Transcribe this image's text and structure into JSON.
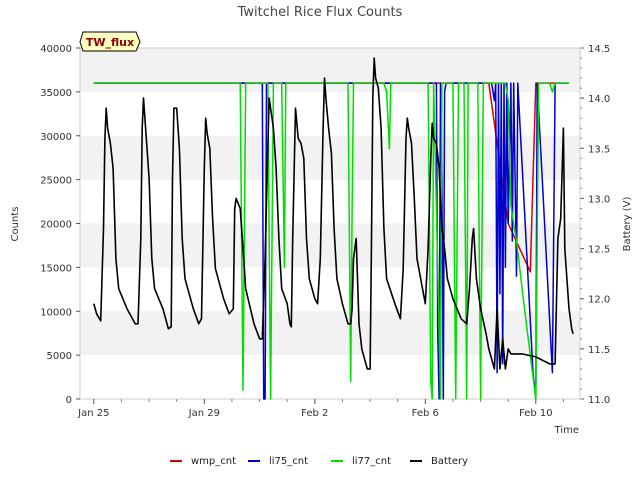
{
  "chart_data": {
    "type": "line",
    "title": "Twitchel Rice Flux Counts",
    "tag_label": "TW_flux",
    "xlabel": "Time",
    "ylabel": "Counts",
    "y2label": "Battery (V)",
    "xlim": [
      -0.5,
      11.6
    ],
    "ylim": [
      0,
      40000
    ],
    "y2lim": [
      11.0,
      14.5
    ],
    "x_ticks": [
      {
        "v": 0,
        "label": "Jan 25"
      },
      {
        "v": 4,
        "label": "Jan 29"
      },
      {
        "v": 8,
        "label": "Feb 2"
      },
      {
        "v": 12,
        "label": "Feb 6"
      },
      {
        "v": 16,
        "label": "Feb 10"
      }
    ],
    "x_tick_day_offset": 0,
    "y_ticks": [
      0,
      5000,
      10000,
      15000,
      20000,
      25000,
      30000,
      35000,
      40000
    ],
    "y2_ticks": [
      "11.0",
      "11.5",
      "12.0",
      "12.5",
      "13.0",
      "13.5",
      "14.0",
      "14.5"
    ],
    "grid": "horizontal bands",
    "legend_position": "bottom",
    "series": [
      {
        "name": "wmp_cnt",
        "color": "#dd0000",
        "axis": "left",
        "points": [
          [
            0,
            36000
          ],
          [
            11.9,
            36000
          ],
          [
            12.1,
            36000
          ],
          [
            13.6,
            36000
          ],
          [
            14.3,
            36000
          ],
          [
            15.0,
            20000
          ],
          [
            15.8,
            14500
          ],
          [
            16.0,
            36000
          ],
          [
            16.7,
            36000
          ]
        ]
      },
      {
        "name": "li75_cnt",
        "color": "#0000cc",
        "axis": "left",
        "points": [
          [
            0,
            36000
          ],
          [
            5.5,
            36000
          ],
          [
            5.9,
            36000
          ],
          [
            6.1,
            36000
          ],
          [
            6.15,
            0
          ],
          [
            6.2,
            0
          ],
          [
            6.25,
            36000
          ],
          [
            8.9,
            36000
          ],
          [
            9.0,
            36000
          ],
          [
            12.4,
            36000
          ],
          [
            12.45,
            8000
          ],
          [
            12.5,
            0
          ],
          [
            12.55,
            36000
          ],
          [
            12.6,
            25000
          ],
          [
            12.65,
            0
          ],
          [
            12.7,
            35000
          ],
          [
            12.75,
            36000
          ],
          [
            14.4,
            36000
          ],
          [
            14.5,
            34000
          ],
          [
            14.55,
            36000
          ],
          [
            14.6,
            3000
          ],
          [
            14.65,
            36000
          ],
          [
            14.7,
            12000
          ],
          [
            14.75,
            36000
          ],
          [
            14.8,
            4000
          ],
          [
            14.85,
            36000
          ],
          [
            14.9,
            15000
          ],
          [
            14.95,
            36000
          ],
          [
            15.0,
            20000
          ],
          [
            15.1,
            36000
          ],
          [
            15.15,
            18000
          ],
          [
            15.2,
            36000
          ],
          [
            15.3,
            14000
          ],
          [
            15.35,
            36000
          ],
          [
            15.9,
            3000
          ],
          [
            16.0,
            0
          ],
          [
            16.05,
            36000
          ],
          [
            16.6,
            3000
          ],
          [
            16.7,
            36000
          ],
          [
            17.2,
            36000
          ]
        ]
      },
      {
        "name": "li77_cnt",
        "color": "#00dd00",
        "axis": "left",
        "points": [
          [
            0,
            36000
          ],
          [
            5.3,
            36000
          ],
          [
            5.4,
            1000
          ],
          [
            5.5,
            36000
          ],
          [
            6.3,
            36000
          ],
          [
            6.4,
            0
          ],
          [
            6.5,
            36000
          ],
          [
            6.8,
            36000
          ],
          [
            6.9,
            15000
          ],
          [
            6.95,
            36000
          ],
          [
            9.2,
            36000
          ],
          [
            9.3,
            2000
          ],
          [
            9.35,
            21500
          ],
          [
            9.4,
            36000
          ],
          [
            10.5,
            36000
          ],
          [
            10.6,
            35000
          ],
          [
            10.7,
            28500
          ],
          [
            10.75,
            36000
          ],
          [
            12.1,
            36000
          ],
          [
            12.2,
            2000
          ],
          [
            12.25,
            0
          ],
          [
            12.3,
            36000
          ],
          [
            12.5,
            8000
          ],
          [
            12.55,
            0
          ],
          [
            12.6,
            36000
          ],
          [
            13.0,
            36000
          ],
          [
            13.1,
            0
          ],
          [
            13.2,
            36000
          ],
          [
            13.4,
            36000
          ],
          [
            13.5,
            0
          ],
          [
            13.55,
            36000
          ],
          [
            13.9,
            36000
          ],
          [
            14.0,
            0
          ],
          [
            14.1,
            36000
          ],
          [
            14.9,
            36000
          ],
          [
            15.0,
            34000
          ],
          [
            15.1,
            22000
          ],
          [
            15.3,
            18000
          ],
          [
            15.6,
            10000
          ],
          [
            15.8,
            5000
          ],
          [
            15.9,
            2500
          ],
          [
            16.0,
            0
          ],
          [
            16.1,
            36000
          ],
          [
            16.5,
            36000
          ],
          [
            16.6,
            35000
          ],
          [
            16.7,
            36000
          ],
          [
            17.2,
            36000
          ]
        ]
      },
      {
        "name": "Battery",
        "color": "#000000",
        "axis": "right",
        "points": [
          [
            0,
            11.95
          ],
          [
            0.1,
            11.85
          ],
          [
            0.25,
            11.78
          ],
          [
            0.35,
            12.7
          ],
          [
            0.4,
            13.6
          ],
          [
            0.45,
            13.9
          ],
          [
            0.5,
            13.7
          ],
          [
            0.6,
            13.55
          ],
          [
            0.7,
            13.3
          ],
          [
            0.8,
            12.4
          ],
          [
            0.9,
            12.1
          ],
          [
            1.2,
            11.9
          ],
          [
            1.5,
            11.75
          ],
          [
            1.6,
            11.75
          ],
          [
            1.7,
            12.6
          ],
          [
            1.75,
            13.7
          ],
          [
            1.8,
            14.0
          ],
          [
            1.9,
            13.6
          ],
          [
            2.0,
            13.2
          ],
          [
            2.1,
            12.4
          ],
          [
            2.2,
            12.1
          ],
          [
            2.5,
            11.9
          ],
          [
            2.7,
            11.7
          ],
          [
            2.8,
            11.72
          ],
          [
            2.85,
            13.2
          ],
          [
            2.9,
            13.9
          ],
          [
            3.0,
            13.9
          ],
          [
            3.1,
            13.5
          ],
          [
            3.2,
            12.6
          ],
          [
            3.3,
            12.2
          ],
          [
            3.6,
            11.9
          ],
          [
            3.8,
            11.75
          ],
          [
            3.9,
            11.8
          ],
          [
            4.0,
            13.3
          ],
          [
            4.05,
            13.8
          ],
          [
            4.1,
            13.65
          ],
          [
            4.2,
            13.5
          ],
          [
            4.3,
            12.8
          ],
          [
            4.4,
            12.3
          ],
          [
            4.7,
            12.0
          ],
          [
            4.9,
            11.85
          ],
          [
            5.05,
            11.9
          ],
          [
            5.1,
            12.9
          ],
          [
            5.15,
            13.0
          ],
          [
            5.3,
            12.9
          ],
          [
            5.4,
            12.5
          ],
          [
            5.5,
            12.1
          ],
          [
            5.8,
            11.75
          ],
          [
            6.0,
            11.6
          ],
          [
            6.1,
            11.6
          ],
          [
            6.2,
            12.4
          ],
          [
            6.3,
            13.5
          ],
          [
            6.35,
            14.0
          ],
          [
            6.4,
            13.9
          ],
          [
            6.5,
            13.7
          ],
          [
            6.6,
            13.3
          ],
          [
            6.7,
            12.6
          ],
          [
            6.8,
            12.1
          ],
          [
            7.0,
            11.95
          ],
          [
            7.1,
            11.75
          ],
          [
            7.15,
            11.72
          ],
          [
            7.2,
            12.6
          ],
          [
            7.3,
            13.9
          ],
          [
            7.4,
            13.6
          ],
          [
            7.5,
            13.55
          ],
          [
            7.6,
            13.4
          ],
          [
            7.7,
            12.6
          ],
          [
            7.8,
            12.2
          ],
          [
            8.0,
            12.0
          ],
          [
            8.1,
            11.95
          ],
          [
            8.2,
            12.4
          ],
          [
            8.3,
            13.7
          ],
          [
            8.35,
            14.2
          ],
          [
            8.4,
            14.0
          ],
          [
            8.5,
            13.7
          ],
          [
            8.6,
            13.45
          ],
          [
            8.7,
            12.7
          ],
          [
            8.8,
            12.2
          ],
          [
            9.0,
            11.95
          ],
          [
            9.2,
            11.75
          ],
          [
            9.3,
            11.75
          ],
          [
            9.35,
            11.9
          ],
          [
            9.4,
            12.4
          ],
          [
            9.5,
            12.6
          ],
          [
            9.6,
            11.75
          ],
          [
            9.7,
            11.5
          ],
          [
            9.8,
            11.4
          ],
          [
            9.9,
            11.3
          ],
          [
            10.0,
            11.3
          ],
          [
            10.05,
            12.5
          ],
          [
            10.1,
            14.0
          ],
          [
            10.15,
            14.4
          ],
          [
            10.2,
            14.2
          ],
          [
            10.3,
            14.1
          ],
          [
            10.4,
            13.7
          ],
          [
            10.5,
            12.7
          ],
          [
            10.6,
            12.2
          ],
          [
            10.9,
            11.95
          ],
          [
            11.1,
            11.8
          ],
          [
            11.2,
            12.3
          ],
          [
            11.3,
            13.6
          ],
          [
            11.35,
            13.8
          ],
          [
            11.4,
            13.7
          ],
          [
            11.5,
            13.55
          ],
          [
            11.6,
            13.0
          ],
          [
            11.7,
            12.4
          ],
          [
            11.9,
            12.1
          ],
          [
            12.0,
            11.95
          ],
          [
            12.1,
            12.5
          ],
          [
            12.2,
            13.4
          ],
          [
            12.25,
            13.75
          ],
          [
            12.3,
            13.6
          ],
          [
            12.4,
            13.55
          ],
          [
            12.5,
            13.3
          ],
          [
            12.6,
            12.7
          ],
          [
            12.7,
            12.5
          ],
          [
            12.8,
            12.2
          ],
          [
            13.0,
            12.0
          ],
          [
            13.3,
            11.8
          ],
          [
            13.5,
            11.75
          ],
          [
            13.6,
            12.1
          ],
          [
            13.7,
            12.6
          ],
          [
            13.75,
            12.7
          ],
          [
            13.85,
            12.2
          ],
          [
            14.0,
            11.9
          ],
          [
            14.2,
            11.65
          ],
          [
            14.3,
            11.5
          ],
          [
            14.4,
            11.4
          ],
          [
            14.5,
            11.3
          ],
          [
            14.6,
            11.9
          ],
          [
            14.7,
            11.3
          ],
          [
            14.8,
            11.6
          ],
          [
            14.9,
            11.3
          ],
          [
            15.0,
            11.5
          ],
          [
            15.1,
            11.45
          ],
          [
            15.5,
            11.45
          ],
          [
            16.0,
            11.42
          ],
          [
            16.5,
            11.35
          ],
          [
            16.7,
            11.35
          ],
          [
            16.8,
            12.6
          ],
          [
            16.9,
            12.8
          ],
          [
            17.0,
            13.7
          ],
          [
            17.05,
            12.5
          ],
          [
            17.2,
            11.9
          ],
          [
            17.3,
            11.7
          ],
          [
            17.35,
            11.65
          ]
        ]
      }
    ]
  }
}
